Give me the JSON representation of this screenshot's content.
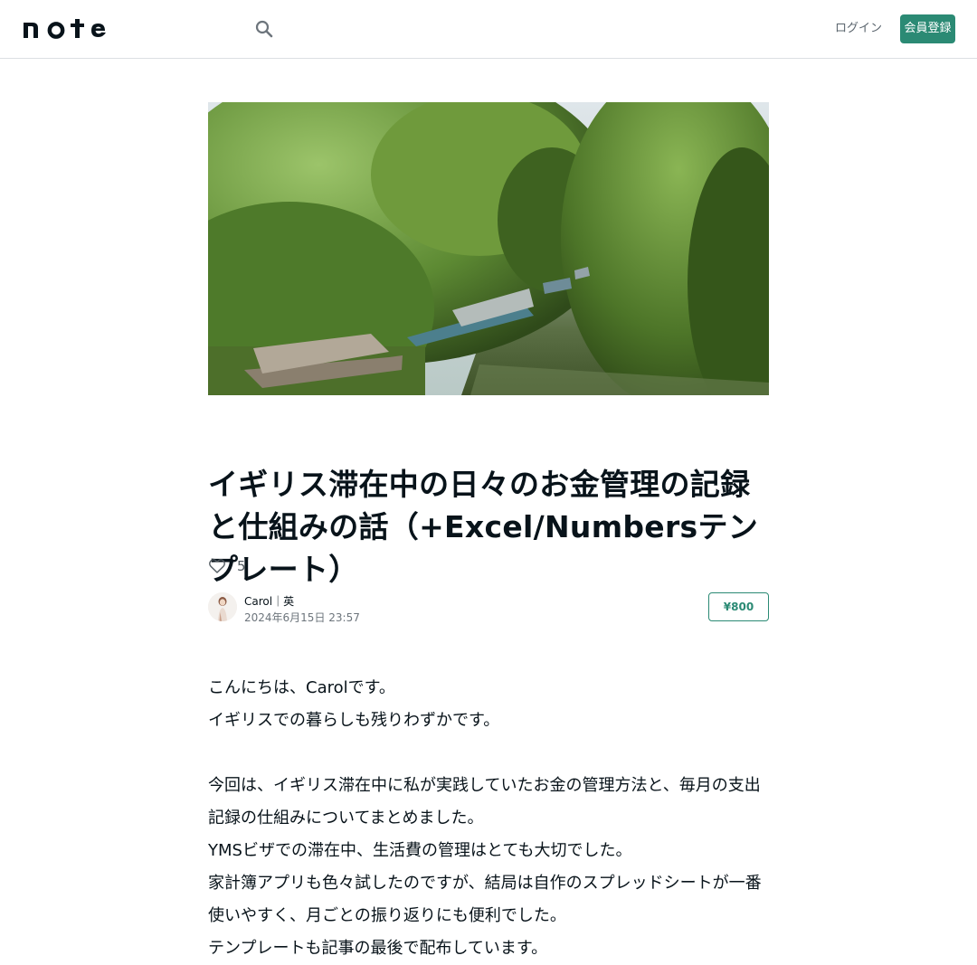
{
  "header": {
    "logo_alt": "note",
    "login_label": "ログイン",
    "signup_label": "会員登録"
  },
  "article": {
    "title": "イギリス滞在中の日々のお金管理の記録と仕組みの話（+Excel/Numbersテンプレート）",
    "like_count": "5",
    "author_name": "Carol｜英",
    "date": "2024年6月15日 23:57",
    "price": "¥800",
    "paragraphs": [
      "こんにちは、Carolです。",
      "イギリスでの暮らしも残りわずかです。",
      "",
      "今回は、イギリス滞在中に私が実践していたお金の管理方法と、毎月の支出記録の仕組みについてまとめました。",
      "YMSビザでの滞在中、生活費の管理はとても大切でした。",
      "家計簿アプリも色々試したのですが、結局は自作のスプレッドシートが一番使いやすく、月ごとの振り返りにも便利でした。",
      "テンプレートも記事の最後で配布しています。"
    ]
  },
  "colors": {
    "accent": "#2b8a74",
    "text": "#08131a",
    "border": "#dcdfe3"
  }
}
